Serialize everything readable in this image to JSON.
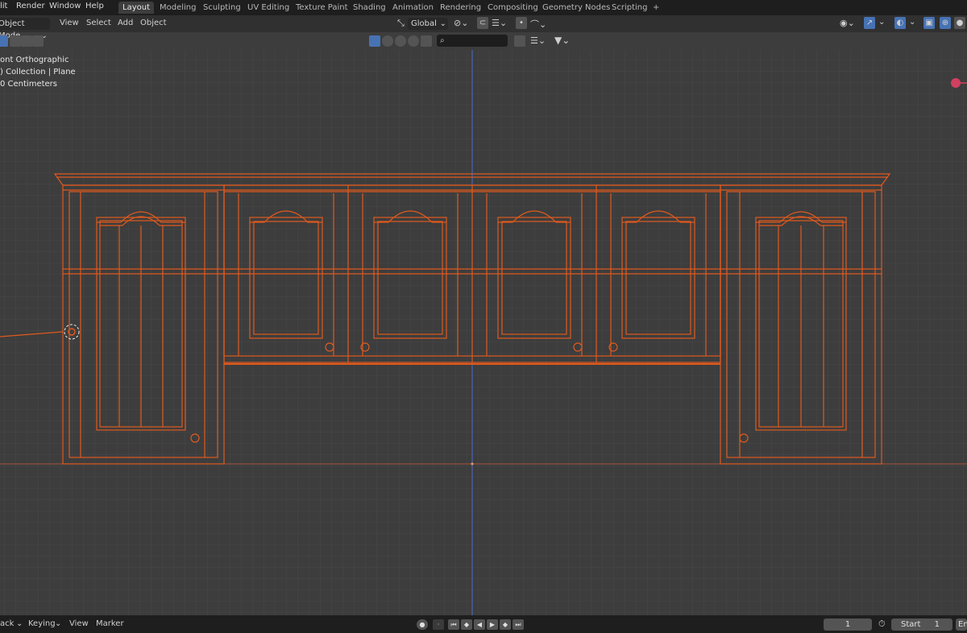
{
  "menu": [
    "lit",
    "Render",
    "Window",
    "Help"
  ],
  "workspaces": [
    "Layout",
    "Modeling",
    "Sculpting",
    "UV Editing",
    "Texture Paint",
    "Shading",
    "Animation",
    "Rendering",
    "Compositing",
    "Geometry Nodes",
    "Scripting"
  ],
  "active_workspace": "Layout",
  "add_workspace": "+",
  "header": {
    "mode": "Object Mode",
    "menus": [
      "View",
      "Select",
      "Add",
      "Object"
    ],
    "orientation": "Global"
  },
  "viewport": {
    "view_name": "ont Orthographic",
    "collection": ") Collection | Plane",
    "units": "0 Centimeters",
    "search_placeholder": ""
  },
  "timeline": {
    "menus": [
      "ack",
      "Keying",
      "View",
      "Marker"
    ],
    "current_frame": "1",
    "start_label": "Start",
    "start_value": "1",
    "end_label": "En"
  },
  "colors": {
    "wire": "#e8591f",
    "background": "#3d3d3d",
    "accent": "#4772b3"
  }
}
